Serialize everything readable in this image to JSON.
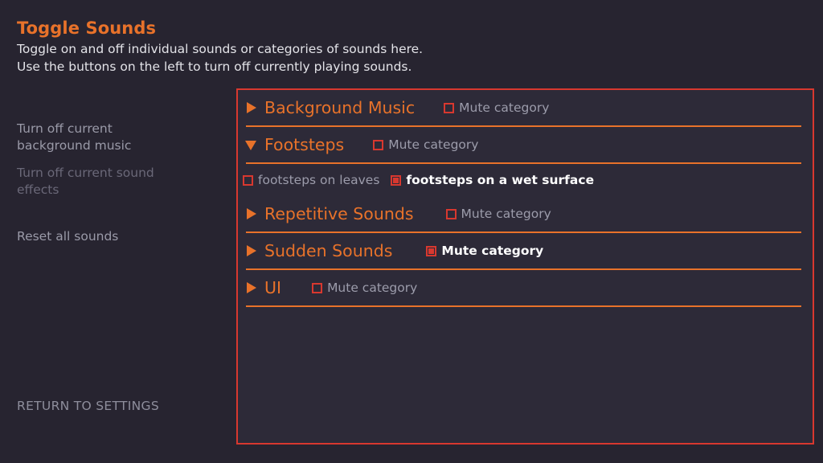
{
  "header": {
    "title": "Toggle Sounds",
    "subtitle_line1": "Toggle on and off individual sounds or categories of sounds here.",
    "subtitle_line2": "Use the buttons on the left to turn off currently playing sounds."
  },
  "sidebar": {
    "buttons": [
      {
        "label": "Turn off current background music",
        "disabled": false
      },
      {
        "label": "Turn off current sound effects",
        "disabled": true
      },
      {
        "label": "Reset all sounds",
        "disabled": false
      }
    ],
    "return_label": "RETURN TO SETTINGS"
  },
  "panel": {
    "mute_label": "Mute category",
    "categories": [
      {
        "name": "Background Music",
        "expanded": false,
        "arrow_icon": "triangle-right-icon",
        "muted": false,
        "mute_gap": 36,
        "sounds": []
      },
      {
        "name": "Footsteps",
        "expanded": true,
        "arrow_icon": "triangle-down-icon",
        "muted": false,
        "mute_gap": 36,
        "sounds": [
          {
            "label": "footsteps on leaves",
            "enabled": false
          },
          {
            "label": "footsteps on a wet surface",
            "enabled": true
          }
        ]
      },
      {
        "name": "Repetitive Sounds",
        "expanded": false,
        "arrow_icon": "triangle-right-icon",
        "muted": false,
        "mute_gap": 40,
        "sounds": []
      },
      {
        "name": "Sudden Sounds",
        "expanded": false,
        "arrow_icon": "triangle-right-icon",
        "muted": true,
        "mute_gap": 42,
        "sounds": []
      },
      {
        "name": "UI",
        "expanded": false,
        "arrow_icon": "triangle-right-icon",
        "muted": false,
        "mute_gap": 38,
        "sounds": []
      }
    ]
  },
  "colors": {
    "background": "#272430",
    "panel_background": "#2d2a38",
    "panel_border": "#d8382f",
    "accent_orange": "#e8722a",
    "checkbox_red": "#d8382f",
    "text_dim": "#9c9cab",
    "text_bright": "#ffffff"
  }
}
